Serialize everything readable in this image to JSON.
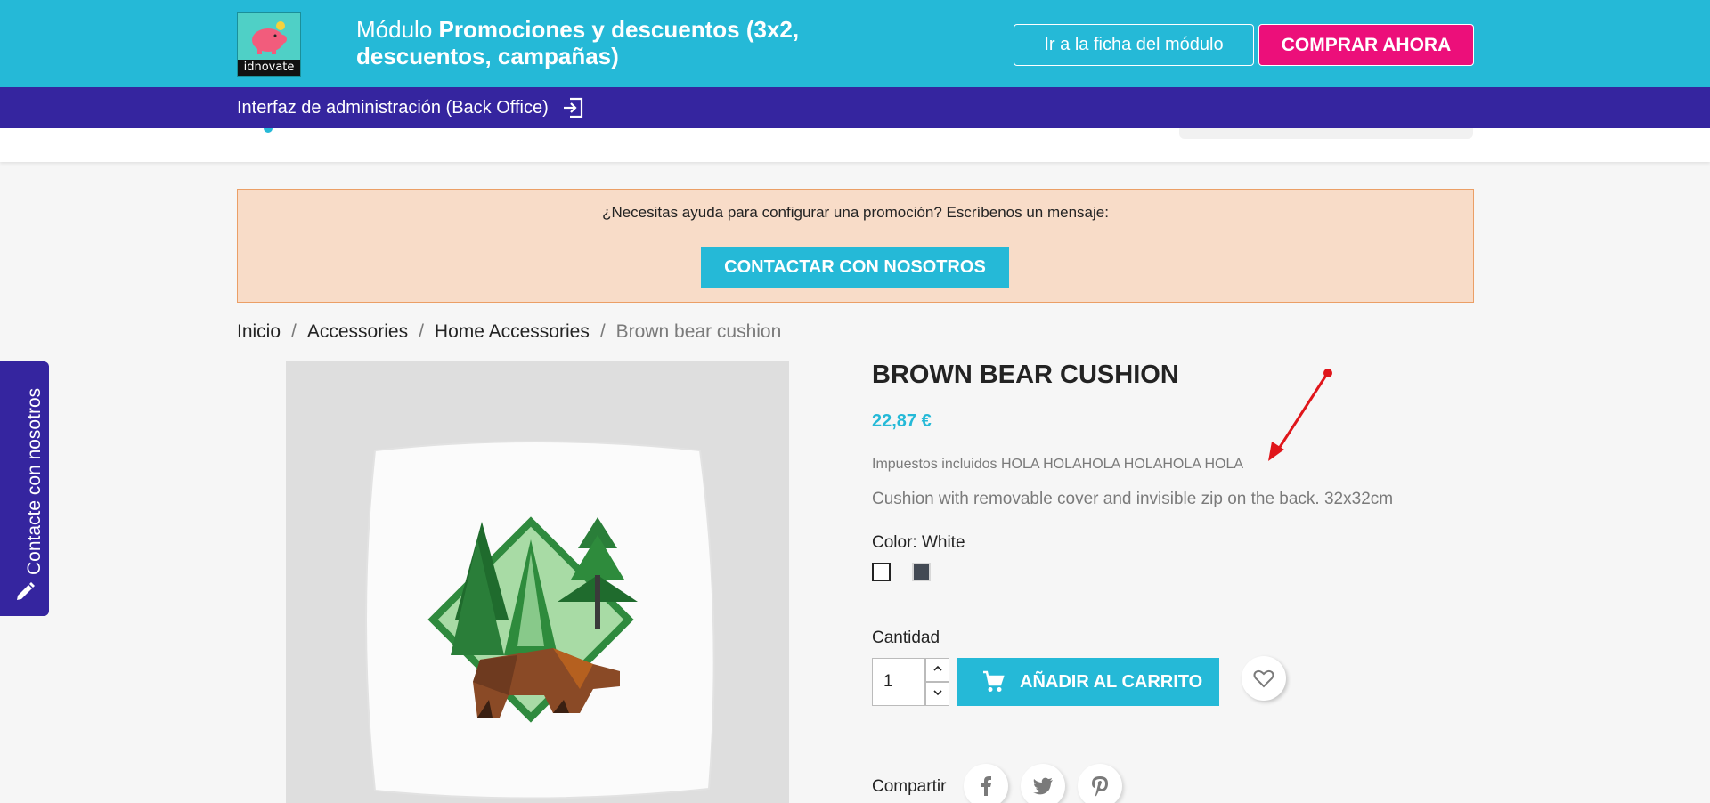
{
  "topbar": {
    "logo_text": "idnovate",
    "title_prefix": "Módulo ",
    "title_bold": "Promociones y descuentos (3x2, descuentos, campañas)",
    "btn_ficha": "Ir a la ficha del módulo",
    "btn_comprar": "COMPRAR AHORA"
  },
  "adminbar": {
    "label": "Interfaz de administración (Back Office)"
  },
  "help": {
    "text": "¿Necesitas ayuda para configurar una promoción? Escríbenos un mensaje:",
    "button": "CONTACTAR CON NOSOTROS"
  },
  "breadcrumb": {
    "items": [
      "Inicio",
      "Accessories",
      "Home Accessories",
      "Brown bear cushion"
    ],
    "separator": "/"
  },
  "sidetab": {
    "label": "Contacte con nosotros"
  },
  "product": {
    "title": "BROWN BEAR CUSHION",
    "price": "22,87 €",
    "tax": "Impuestos incluidos HOLA HOLAHOLA HOLAHOLA HOLA",
    "description": "Cushion with removable cover and invisible zip on the back. 32x32cm",
    "color_label": "Color: White",
    "colors": [
      "White",
      "Grey"
    ],
    "quantity_label": "Cantidad",
    "quantity_value": "1",
    "add_to_cart": "AÑADIR AL CARRITO",
    "share_label": "Compartir"
  },
  "colors": {
    "primary": "#25b9d7",
    "admin_bar": "#35259f",
    "buy_button": "#ec0f7a",
    "help_bg": "#f8dcc8",
    "annotation_arrow": "#e0161b"
  }
}
